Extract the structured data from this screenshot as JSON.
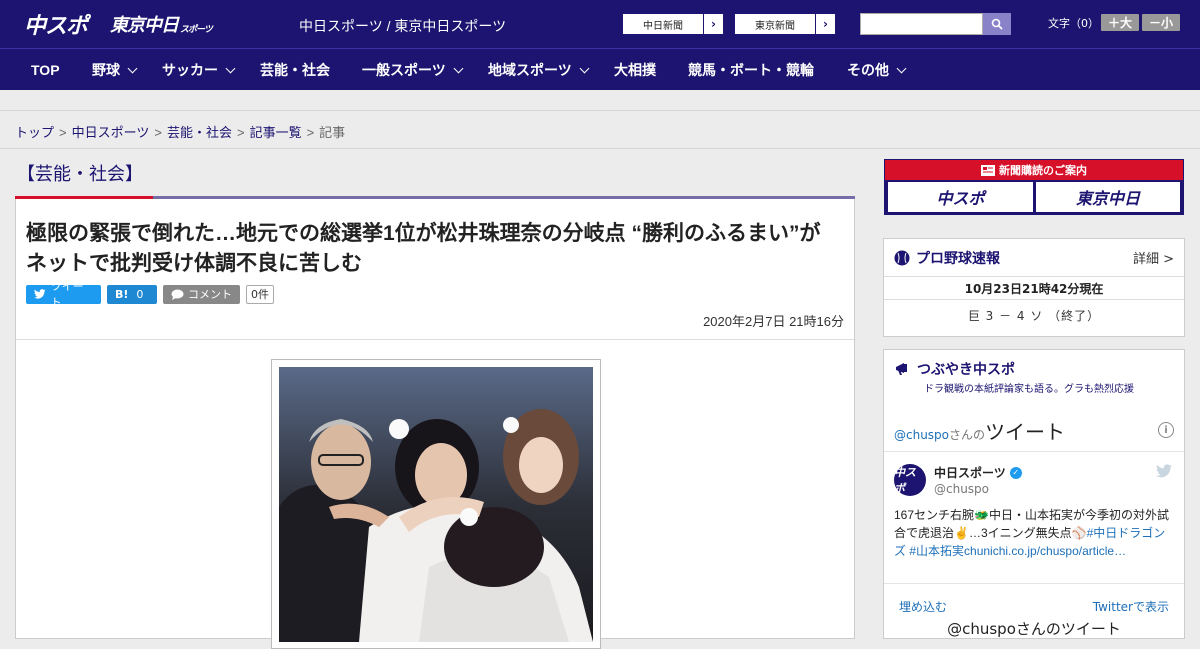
{
  "header": {
    "logo_chuspo": "中スポ",
    "logo_tokyo": "東京中日",
    "logo_tokyo_sub": "スポーツ",
    "site_title": "中日スポーツ / 東京中日スポーツ",
    "ext_links": [
      "中日新聞",
      "東京新聞"
    ],
    "search_placeholder": "",
    "font_label": "文字（0）",
    "font_plus": "＋大",
    "font_minus": "－小"
  },
  "nav": {
    "items": [
      {
        "label": "TOP",
        "dropdown": false
      },
      {
        "label": "野球",
        "dropdown": true
      },
      {
        "label": "サッカー",
        "dropdown": true
      },
      {
        "label": "芸能・社会",
        "dropdown": false
      },
      {
        "label": "一般スポーツ",
        "dropdown": true
      },
      {
        "label": "地域スポーツ",
        "dropdown": true
      },
      {
        "label": "大相撲",
        "dropdown": false
      },
      {
        "label": "競馬・ボート・競輪",
        "dropdown": false
      },
      {
        "label": "その他",
        "dropdown": true
      }
    ]
  },
  "breadcrumb": {
    "items": [
      "トップ",
      "中日スポーツ",
      "芸能・社会",
      "記事一覧"
    ],
    "current": "記事",
    "separator": ">"
  },
  "article": {
    "category": "【芸能・社会】",
    "headline": "極限の緊張で倒れた…地元での総選挙1位が松井珠理奈の分岐点 “勝利のふるまい”がネットで批判受け体調不良に苦しむ",
    "tweet_label": "ツイート",
    "hatena_label": "B!",
    "hatena_count": "0",
    "comment_label": "コメント",
    "comment_count": "0件",
    "date": "2020年2月7日 21時16分"
  },
  "sidebar": {
    "subscription": {
      "heading": "新聞購読のご案内",
      "logo_left": "中スポ",
      "logo_right": "東京中日"
    },
    "baseball": {
      "title": "プロ野球速報",
      "detail": "詳細 >",
      "timestamp": "10月23日21時42分現在",
      "score": "巨 3 － 4 ソ （終了）"
    },
    "tweets": {
      "title": "つぶやき中スポ",
      "subtitle": "ドラ観戦の本紙評論家も語る。グラも熱烈応援",
      "header_handle": "@chuspo",
      "header_suffix": "さんの",
      "header_big": "ツイート",
      "info": "i",
      "account_name": "中日スポーツ",
      "account_handle": "@chuspo",
      "avatar_text": "中スポ",
      "tweet_text": "167センチ右腕🐲中日・山本拓実が今季初の対外試合で虎退治✌…3イニング無失点⚾",
      "tweet_tags": "#中日ドラゴンズ #山本拓実",
      "tweet_link": "chunichi.co.jp/chuspo/article…",
      "embed": "埋め込む",
      "view_on_twitter": "Twitterで表示",
      "footer": "@chuspoさんのツイート"
    }
  },
  "colors": {
    "brand_navy": "#1c1470",
    "accent_red": "#d7102a",
    "twitter_blue": "#1d9bf0"
  }
}
